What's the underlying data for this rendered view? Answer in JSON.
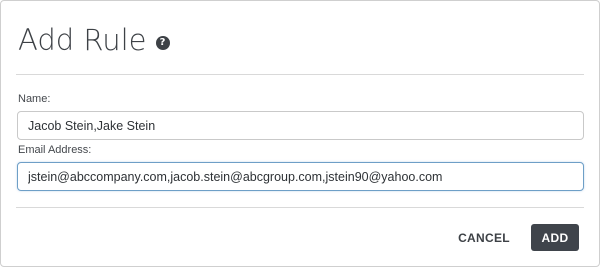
{
  "dialog": {
    "title": "Add Rule",
    "help_icon": "question-circle-icon",
    "help_glyph": "?"
  },
  "form": {
    "name_label": "Name:",
    "name_value": "Jacob Stein,Jake Stein",
    "email_label": "Email Address:",
    "email_value": "jstein@abccompany.com,jacob.stein@abcgroup.com,jstein90@yahoo.com"
  },
  "actions": {
    "cancel_label": "CANCEL",
    "add_label": "ADD"
  },
  "colors": {
    "primary_button": "#3f444b",
    "focused_border": "#6e9fc7",
    "text": "#3d4146"
  }
}
